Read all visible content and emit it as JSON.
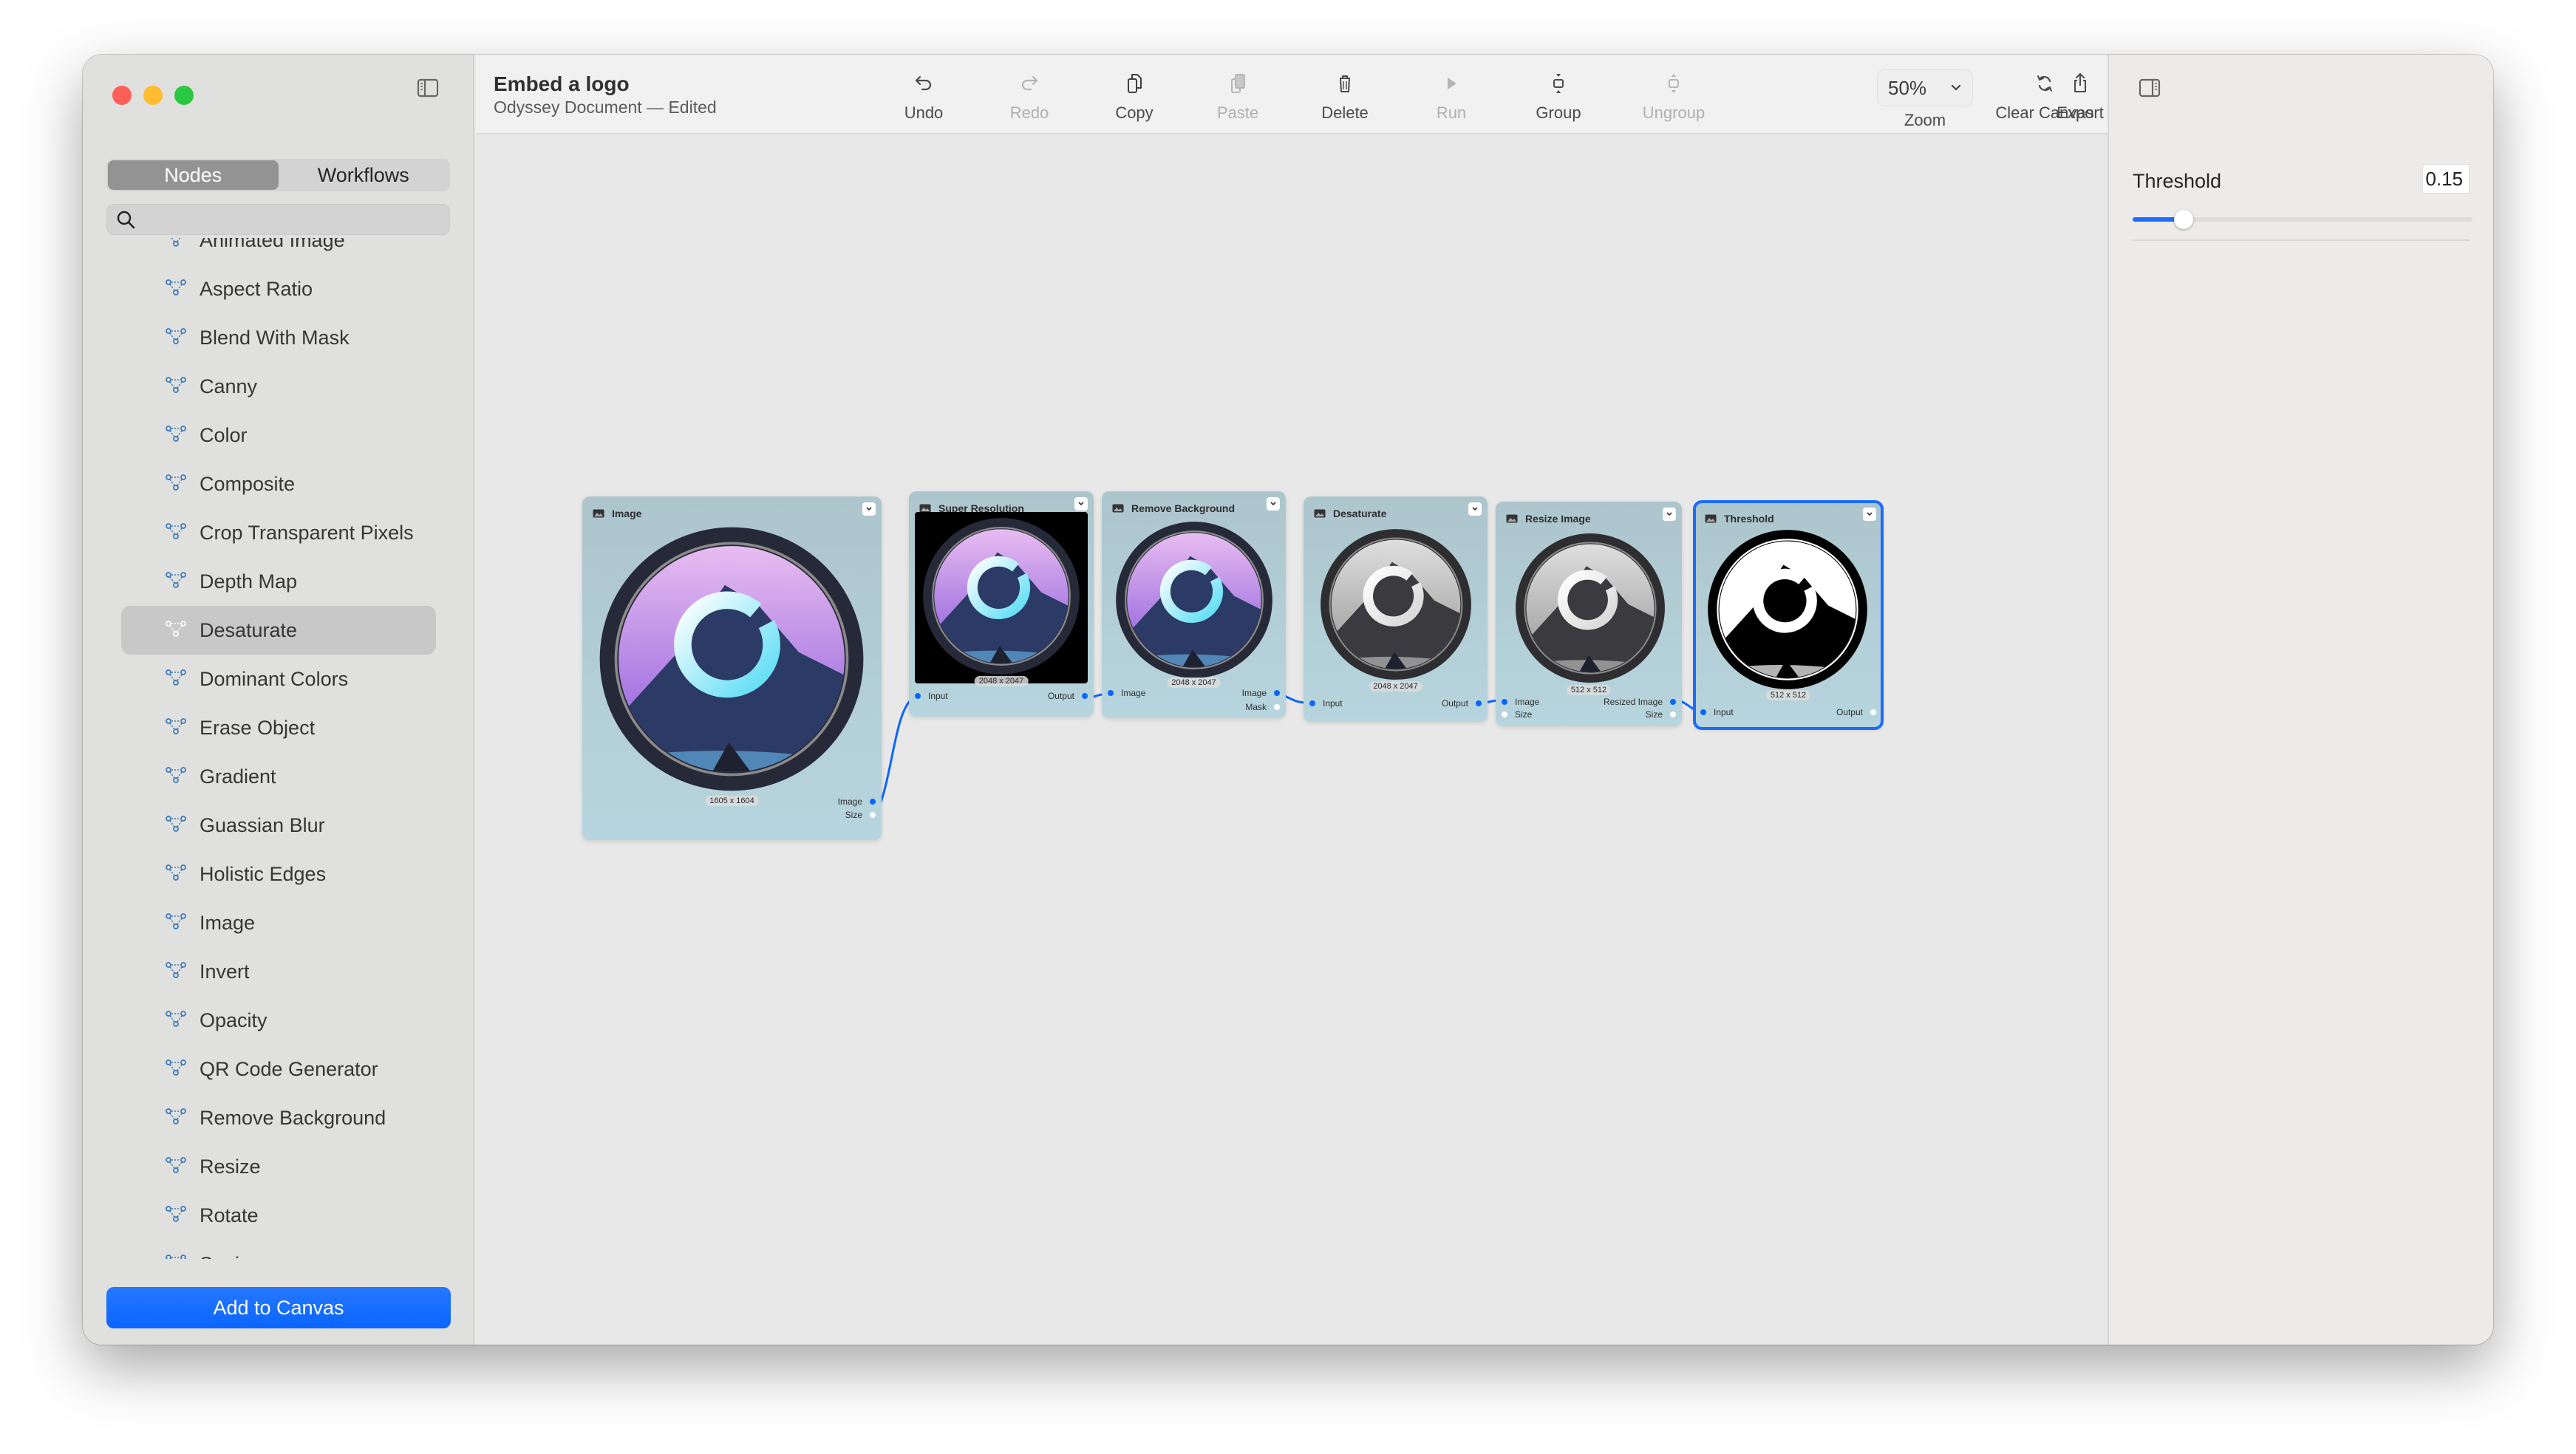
{
  "document": {
    "title": "Embed a logo",
    "subtitle": "Odyssey Document — Edited"
  },
  "sidebar": {
    "tabs": [
      {
        "label": "Nodes",
        "active": true
      },
      {
        "label": "Workflows",
        "active": false
      }
    ],
    "search": {
      "placeholder": "",
      "value": ""
    },
    "items": [
      {
        "label": "Animated Image",
        "selected": false
      },
      {
        "label": "Aspect Ratio",
        "selected": false
      },
      {
        "label": "Blend With Mask",
        "selected": false
      },
      {
        "label": "Canny",
        "selected": false
      },
      {
        "label": "Color",
        "selected": false
      },
      {
        "label": "Composite",
        "selected": false
      },
      {
        "label": "Crop Transparent Pixels",
        "selected": false
      },
      {
        "label": "Depth Map",
        "selected": false
      },
      {
        "label": "Desaturate",
        "selected": true
      },
      {
        "label": "Dominant Colors",
        "selected": false
      },
      {
        "label": "Erase Object",
        "selected": false
      },
      {
        "label": "Gradient",
        "selected": false
      },
      {
        "label": "Guassian Blur",
        "selected": false
      },
      {
        "label": "Holistic Edges",
        "selected": false
      },
      {
        "label": "Image",
        "selected": false
      },
      {
        "label": "Invert",
        "selected": false
      },
      {
        "label": "Opacity",
        "selected": false
      },
      {
        "label": "QR Code Generator",
        "selected": false
      },
      {
        "label": "Remove Background",
        "selected": false
      },
      {
        "label": "Resize",
        "selected": false
      },
      {
        "label": "Rotate",
        "selected": false
      },
      {
        "label": "Sepia",
        "selected": false
      }
    ],
    "add_button": "Add to Canvas"
  },
  "toolbar": {
    "buttons": [
      {
        "label": "Undo",
        "icon": "undo-icon",
        "enabled": true
      },
      {
        "label": "Redo",
        "icon": "redo-icon",
        "enabled": false
      },
      {
        "label": "Copy",
        "icon": "copy-icon",
        "enabled": true
      },
      {
        "label": "Paste",
        "icon": "paste-icon",
        "enabled": false
      },
      {
        "label": "Delete",
        "icon": "trash-icon",
        "enabled": true
      },
      {
        "label": "Run",
        "icon": "play-icon",
        "enabled": false
      },
      {
        "label": "Group",
        "icon": "group-icon",
        "enabled": true
      },
      {
        "label": "Ungroup",
        "icon": "ungroup-icon",
        "enabled": false
      },
      {
        "label": "Clear Canvas",
        "icon": "refresh-icon",
        "enabled": true
      },
      {
        "label": "Export",
        "icon": "share-icon",
        "enabled": true
      }
    ],
    "zoom": {
      "value": "50%",
      "label": "Zoom"
    }
  },
  "canvas": {
    "nodes": [
      {
        "title": "Image",
        "dims": "1605 x 1604",
        "inputs": [],
        "outputs": [
          {
            "label": "Image",
            "connected": true
          },
          {
            "label": "Size",
            "connected": false
          }
        ],
        "preview": "color",
        "selected": false
      },
      {
        "title": "Super Resolution",
        "dims": "2048 x 2047",
        "inputs": [
          {
            "label": "Input",
            "connected": true
          }
        ],
        "outputs": [
          {
            "label": "Output",
            "connected": true
          }
        ],
        "preview": "color-black-bg",
        "selected": false
      },
      {
        "title": "Remove Background",
        "dims": "2048 x 2047",
        "inputs": [
          {
            "label": "Image",
            "connected": true
          }
        ],
        "outputs": [
          {
            "label": "Image",
            "connected": true
          },
          {
            "label": "Mask",
            "connected": false
          }
        ],
        "preview": "color",
        "selected": false
      },
      {
        "title": "Desaturate",
        "dims": "2048 x 2047",
        "inputs": [
          {
            "label": "Input",
            "connected": true
          }
        ],
        "outputs": [
          {
            "label": "Output",
            "connected": true
          }
        ],
        "preview": "gray",
        "selected": false
      },
      {
        "title": "Resize Image",
        "dims": "512 x 512",
        "inputs": [
          {
            "label": "Image",
            "connected": true
          },
          {
            "label": "Size",
            "connected": false
          }
        ],
        "outputs": [
          {
            "label": "Resized Image",
            "connected": true
          },
          {
            "label": "Size",
            "connected": false
          }
        ],
        "preview": "gray",
        "selected": false
      },
      {
        "title": "Threshold",
        "dims": "512 x 512",
        "inputs": [
          {
            "label": "Input",
            "connected": true
          }
        ],
        "outputs": [
          {
            "label": "Output",
            "connected": false
          }
        ],
        "preview": "bw",
        "selected": true
      }
    ]
  },
  "inspector": {
    "param_label": "Threshold",
    "param_value": "0.15",
    "slider_fraction": 0.15
  },
  "colors": {
    "accent": "#0a66fe",
    "node_bg": "#b2ccd4",
    "traffic_close": "#fe5f57",
    "traffic_min": "#febc2e",
    "traffic_max": "#28c840"
  }
}
